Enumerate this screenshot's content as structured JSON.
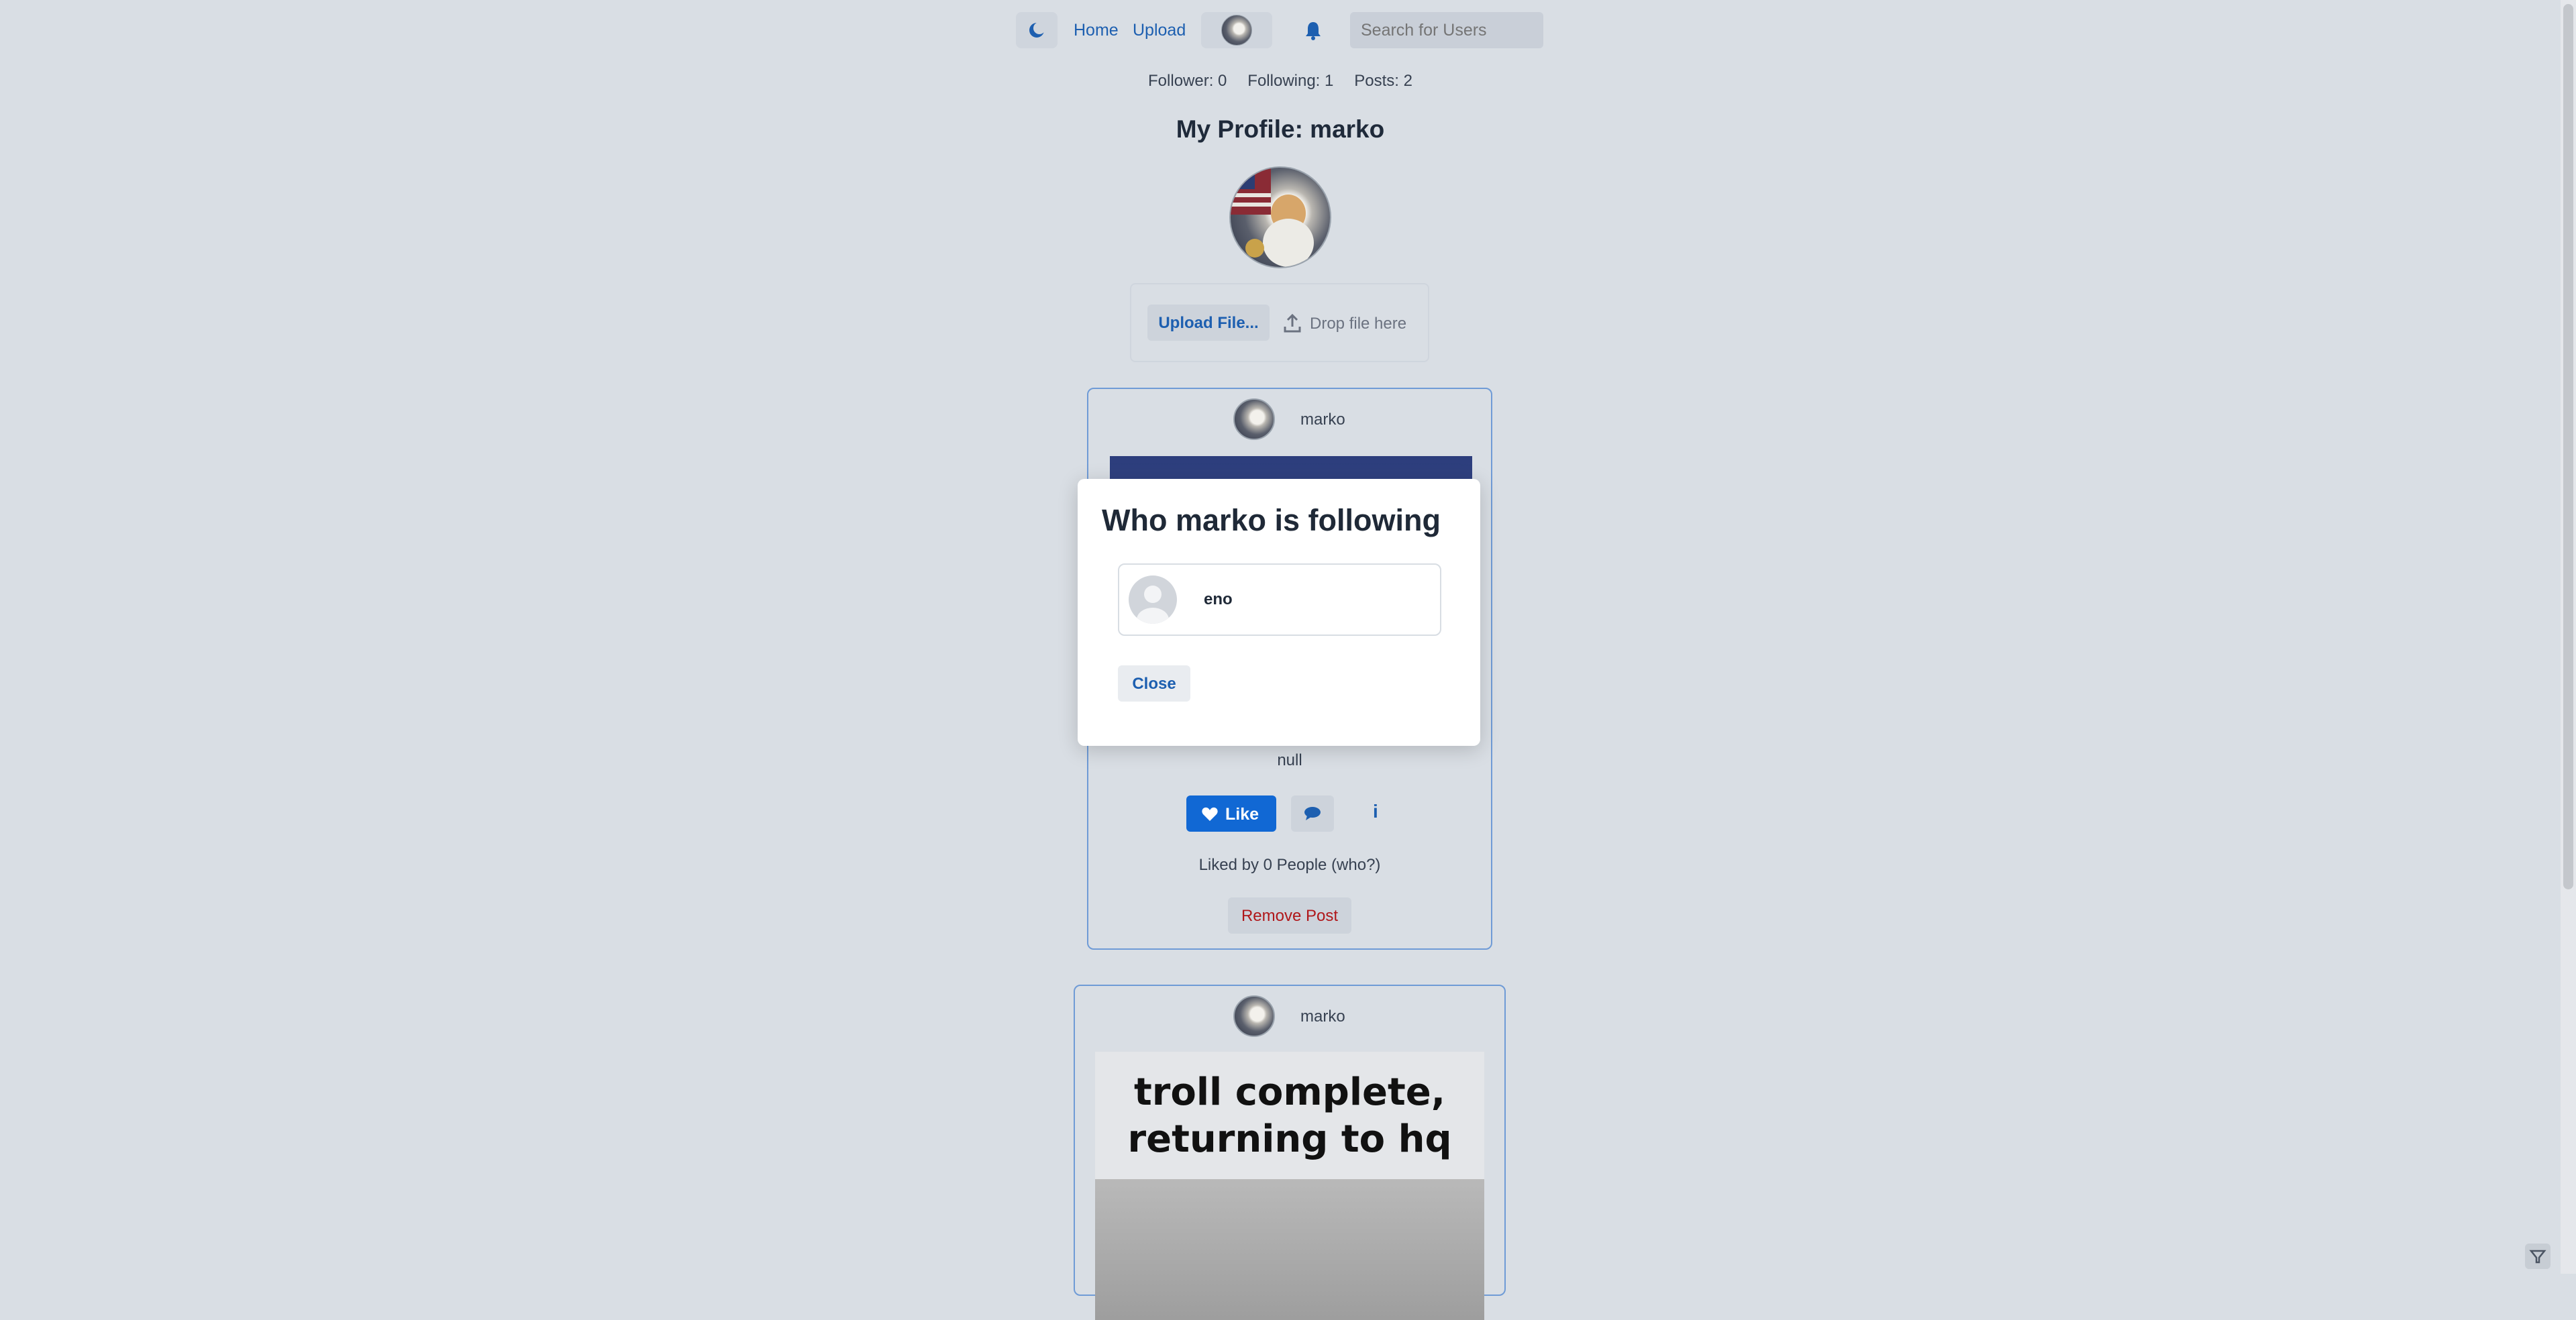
{
  "nav": {
    "home_label": "Home",
    "upload_label": "Upload",
    "search_placeholder": "Search for Users"
  },
  "stats": {
    "follower": "Follower: 0",
    "following": "Following: 1",
    "posts": "Posts: 2"
  },
  "profile": {
    "title": "My Profile: marko"
  },
  "uploader": {
    "button_label": "Upload File...",
    "drop_label": "Drop file here"
  },
  "post1": {
    "username": "marko",
    "caption": "null",
    "like_label": "Like",
    "info_label": "i",
    "liked_by": "Liked by 0 People (who?)",
    "remove_label": "Remove Post"
  },
  "post2": {
    "username": "marko",
    "meme_line1": "troll complete,",
    "meme_line2": "returning to hq"
  },
  "modal": {
    "title": "Who marko is following",
    "users": [
      {
        "name": "eno"
      }
    ],
    "close_label": "Close"
  },
  "colors": {
    "accent": "#1168d4",
    "danger": "#b0171a",
    "background": "#d9dee4"
  }
}
